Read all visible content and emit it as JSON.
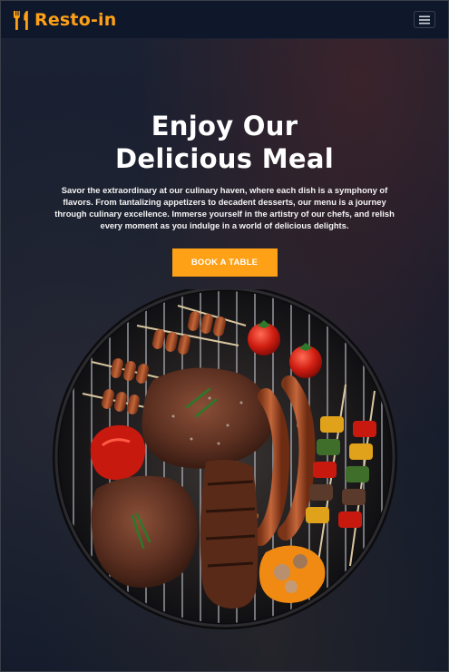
{
  "navbar": {
    "brand_name": "Resto-in",
    "brand_icon": "utensils-icon",
    "menu_icon": "hamburger-menu-icon"
  },
  "hero": {
    "title_line1": "Enjoy Our",
    "title_line2": "Delicious Meal",
    "description": "Savor the extraordinary at our culinary haven, where each dish is a symphony of flavors. From tantalizing appetizers to decadent desserts, our menu is a journey through culinary excellence. Immerse yourself in the artistry of our chefs, and relish every moment as you indulge in a world of delicious delights.",
    "cta_label": "BOOK A TABLE"
  },
  "image": {
    "name": "bbq-grill-image"
  },
  "colors": {
    "brand": "#fea116",
    "navbar_bg": "#0f172b",
    "text": "#ffffff"
  }
}
